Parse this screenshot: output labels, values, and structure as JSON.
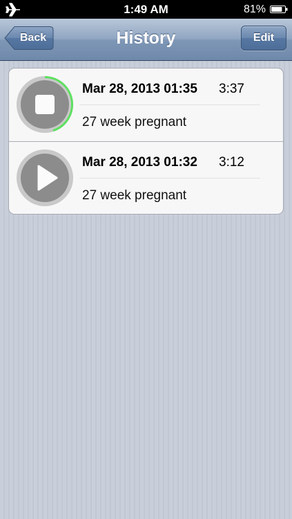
{
  "status_bar": {
    "time": "1:49 AM",
    "battery_percent": "81%",
    "battery_level": 0.81,
    "left_icon": "airplane-mode-icon"
  },
  "nav": {
    "title": "History",
    "back_label": "Back",
    "edit_label": "Edit"
  },
  "recordings": [
    {
      "date": "Mar 28, 2013 01:35",
      "duration": "3:37",
      "note": "27 week pregnant",
      "state": "playing",
      "icon": "stop-icon",
      "progress": 0.45
    },
    {
      "date": "Mar 28, 2013 01:32",
      "duration": "3:12",
      "note": "27 week pregnant",
      "state": "stopped",
      "icon": "play-icon",
      "progress": 0
    }
  ],
  "colors": {
    "progress_ring": "#5ee060",
    "nav_bar": "#7f97b6",
    "background": "#c6ccd8"
  }
}
